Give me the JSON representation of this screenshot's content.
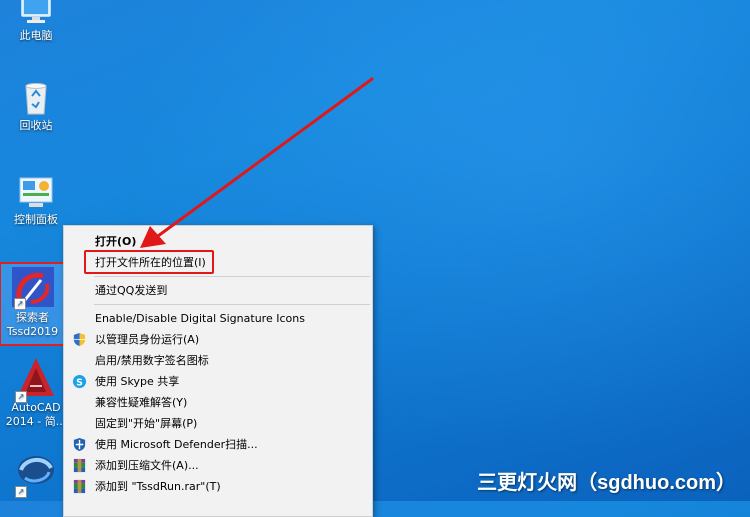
{
  "desktop_icons": [
    {
      "label": "此电脑"
    },
    {
      "label": "回收站"
    },
    {
      "label": "控制面板"
    },
    {
      "label": "探索者\nTssd2019"
    },
    {
      "label": "AutoCAD\n2014 - 简..."
    },
    {
      "label": ""
    }
  ],
  "context_menu": {
    "items": [
      {
        "label": "打开(O)",
        "bold": true,
        "icon": ""
      },
      {
        "label": "打开文件所在的位置(I)",
        "icon": ""
      },
      {
        "label": "通过QQ发送到",
        "icon": ""
      },
      {
        "label": "Enable/Disable Digital Signature Icons",
        "icon": ""
      },
      {
        "label": "以管理员身份运行(A)",
        "icon": "uac-shield-icon"
      },
      {
        "label": "启用/禁用数字签名图标",
        "icon": ""
      },
      {
        "label": "使用 Skype 共享",
        "icon": "skype-icon"
      },
      {
        "label": "兼容性疑难解答(Y)",
        "icon": ""
      },
      {
        "label": "固定到\"开始\"屏幕(P)",
        "icon": ""
      },
      {
        "label": "使用 Microsoft Defender扫描...",
        "icon": "defender-shield-icon"
      },
      {
        "label": "添加到压缩文件(A)...",
        "icon": "winrar-icon"
      },
      {
        "label": "添加到 \"TssdRun.rar\"(T)",
        "icon": "winrar-icon"
      }
    ]
  },
  "watermark": "三更灯火网（sgdhuo.com）",
  "colors": {
    "annotation_red": "#e01818",
    "desktop_blue": "#1687dc"
  }
}
